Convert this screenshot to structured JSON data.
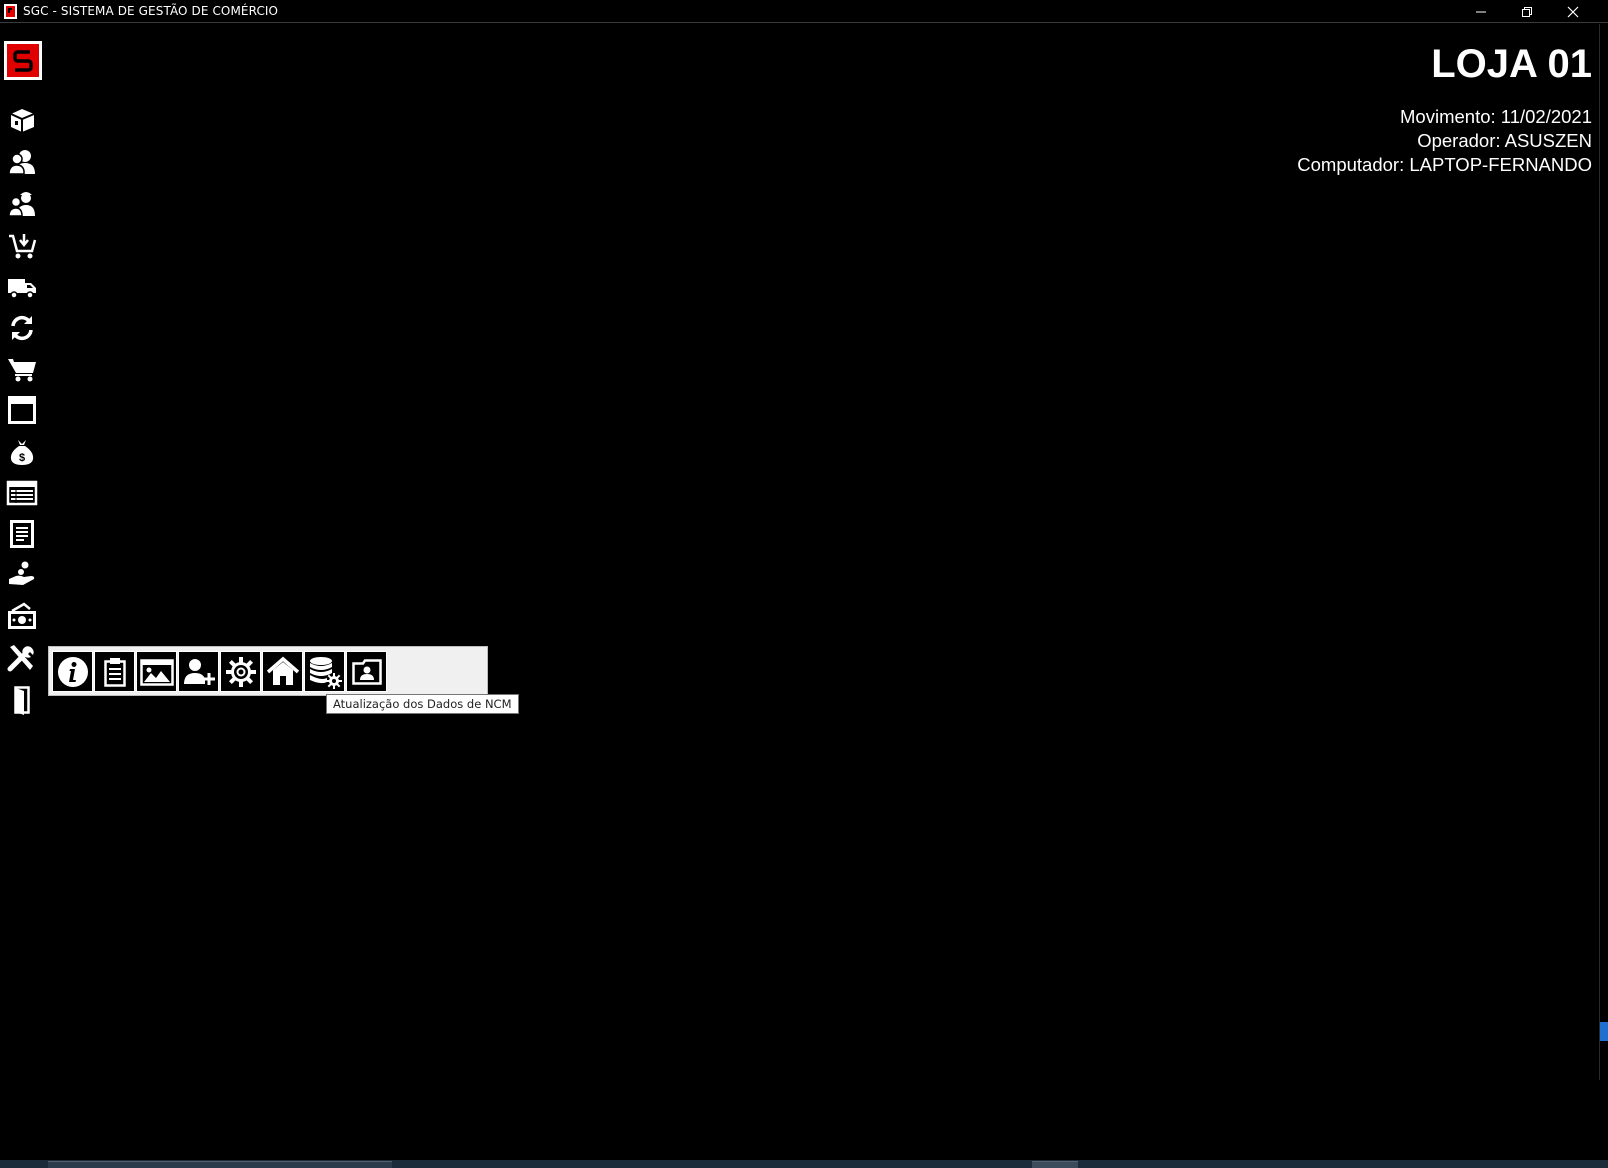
{
  "window": {
    "title": "SGC - SISTEMA DE GESTÃO DE COMÉRCIO",
    "controls": [
      "minimize-icon",
      "restore-icon",
      "close-icon"
    ]
  },
  "header": {
    "store": "LOJA 01",
    "movimento": "Movimento: 11/02/2021",
    "operador": "Operador: ASUSZEN",
    "computador": "Computador: LAPTOP-FERNANDO"
  },
  "sidebar": {
    "icons": [
      "box-icon",
      "users-icon",
      "worker-icon",
      "cart-download-icon",
      "truck-icon",
      "refresh-icon",
      "shopping-cart-icon",
      "window-icon",
      "money-bag-icon",
      "list-icon",
      "receipt-icon",
      "hand-coin-icon",
      "cash-register-icon",
      "tools-icon",
      "exit-door-icon"
    ]
  },
  "toolbar": {
    "icons": [
      "info-icon",
      "clipboard-icon",
      "image-icon",
      "add-user-icon",
      "settings-gear-icon",
      "home-icon",
      "database-settings-icon",
      "user-folder-icon"
    ],
    "tooltip": "Atualização dos Dados de NCM"
  },
  "colors": {
    "background": "#000000",
    "logo_red": "#e00000",
    "popup_bg": "#f0f0f0",
    "scroll_accent": "#1f6fd0"
  }
}
